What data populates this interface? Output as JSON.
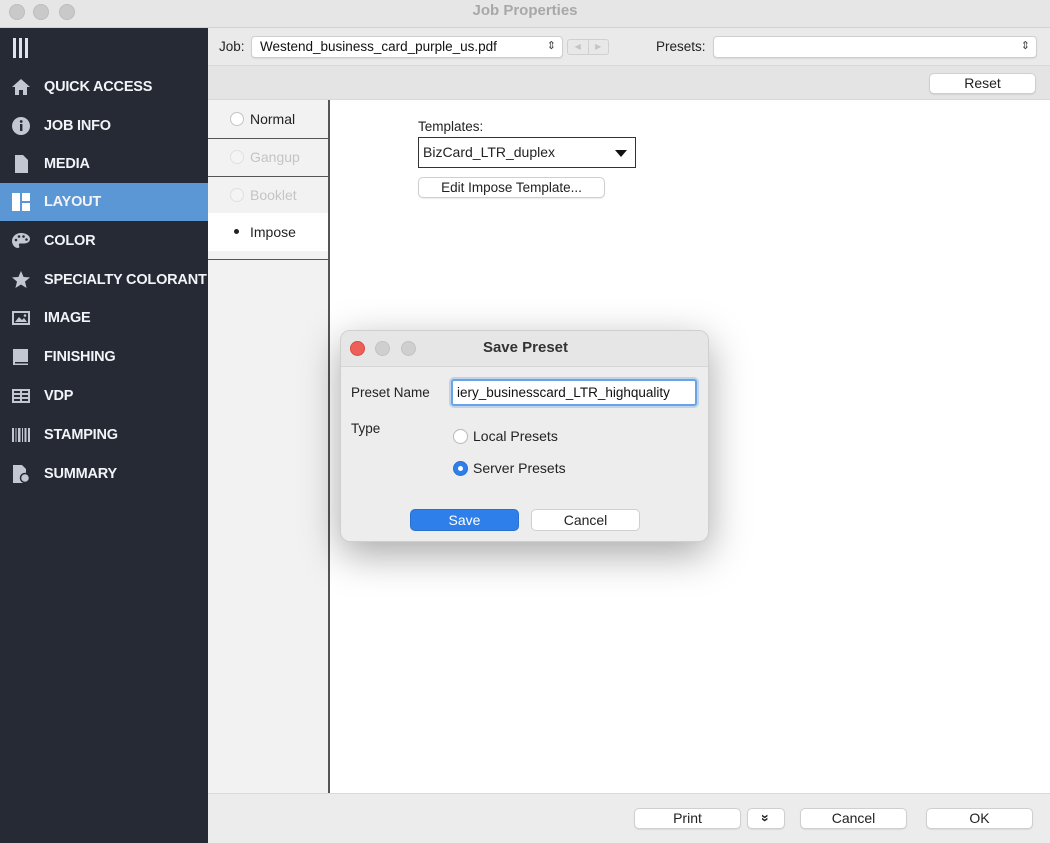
{
  "window": {
    "title": "Job Properties"
  },
  "sidebar": {
    "items": [
      {
        "label": "QUICK ACCESS",
        "icon": "home-icon"
      },
      {
        "label": "JOB INFO",
        "icon": "info-icon"
      },
      {
        "label": "MEDIA",
        "icon": "document-icon"
      },
      {
        "label": "LAYOUT",
        "icon": "layout-icon",
        "active": true
      },
      {
        "label": "COLOR",
        "icon": "palette-icon"
      },
      {
        "label": "SPECIALTY COLORANT",
        "icon": "star-icon"
      },
      {
        "label": "IMAGE",
        "icon": "image-icon"
      },
      {
        "label": "FINISHING",
        "icon": "finishing-icon"
      },
      {
        "label": "VDP",
        "icon": "vdp-icon"
      },
      {
        "label": "STAMPING",
        "icon": "stamping-icon"
      },
      {
        "label": "SUMMARY",
        "icon": "summary-icon"
      }
    ]
  },
  "jobbar": {
    "job_label": "Job:",
    "job_value": "Westend_business_card_purple_us.pdf",
    "presets_label": "Presets:",
    "presets_value": ""
  },
  "resetbar": {
    "reset_label": "Reset"
  },
  "layout": {
    "options": [
      {
        "label": "Normal",
        "state": "enabled"
      },
      {
        "label": "Gangup",
        "state": "disabled"
      },
      {
        "label": "Booklet",
        "state": "disabled"
      },
      {
        "label": "Impose",
        "state": "selected"
      }
    ],
    "templates_label": "Templates:",
    "templates_value": "BizCard_LTR_duplex",
    "edit_template_label": "Edit Impose Template..."
  },
  "bottombar": {
    "print_label": "Print",
    "more_label": "»",
    "cancel_label": "Cancel",
    "ok_label": "OK"
  },
  "dialog": {
    "title": "Save Preset",
    "preset_name_label": "Preset Name",
    "preset_name_value": "iery_businesscard_LTR_highquality",
    "type_label": "Type",
    "local_label": "Local Presets",
    "server_label": "Server Presets",
    "selected_type": "server",
    "save_label": "Save",
    "cancel_label": "Cancel"
  },
  "colors": {
    "sidebar_bg": "#252a35",
    "sidebar_active": "#5c97d5",
    "accent_blue": "#2f7fea",
    "close_red": "#ee5f57"
  }
}
